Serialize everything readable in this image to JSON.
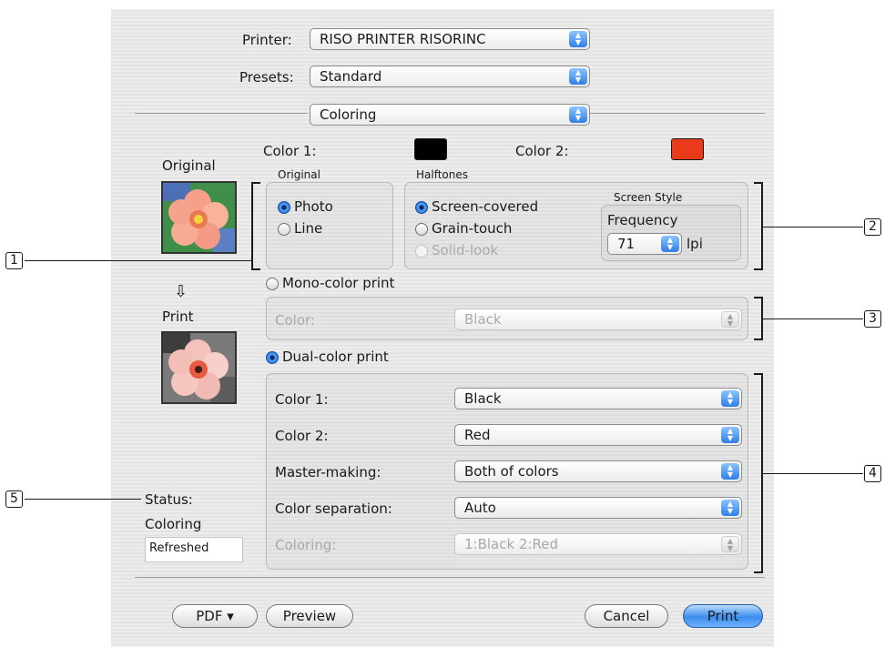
{
  "dialog": {
    "printer_label": "Printer:",
    "printer_value": "RISO PRINTER RISORINC",
    "presets_label": "Presets:",
    "presets_value": "Standard",
    "panel_value": "Coloring"
  },
  "colors": {
    "color1_label": "Color 1:",
    "color1_swatch": "#000000",
    "color2_label": "Color 2:",
    "color2_swatch": "#ea3a1c",
    "accent": "#2f7fe6"
  },
  "preview": {
    "original_label": "Original",
    "print_label": "Print",
    "arrow_glyph": "⇩"
  },
  "original_group": {
    "title": "Original",
    "options": [
      "Photo",
      "Line"
    ],
    "selected": "Photo"
  },
  "halftones_group": {
    "title": "Halftones",
    "options": [
      "Screen-covered",
      "Grain-touch",
      "Solid-look"
    ],
    "selected": "Screen-covered",
    "screen_style_title": "Screen Style",
    "frequency_label": "Frequency",
    "frequency_value": "71",
    "frequency_unit": "lpi"
  },
  "mono": {
    "radio_label": "Mono-color print",
    "color_label": "Color:",
    "color_value": "Black"
  },
  "dual": {
    "radio_label": "Dual-color print",
    "rows": [
      {
        "label": "Color 1:",
        "value": "Black"
      },
      {
        "label": "Color 2:",
        "value": "Red"
      },
      {
        "label": "Master-making:",
        "value": "Both of colors"
      },
      {
        "label": "Color separation:",
        "value": "Auto"
      },
      {
        "label": "Coloring:",
        "value": "1:Black 2:Red"
      }
    ]
  },
  "status": {
    "title": "Status:",
    "subtitle": "Coloring",
    "value": "Refreshed"
  },
  "buttons": {
    "pdf": "PDF ▾",
    "preview": "Preview",
    "cancel": "Cancel",
    "print": "Print"
  },
  "callouts": [
    "1",
    "2",
    "3",
    "4",
    "5"
  ],
  "popup_arrows": "▲▼"
}
